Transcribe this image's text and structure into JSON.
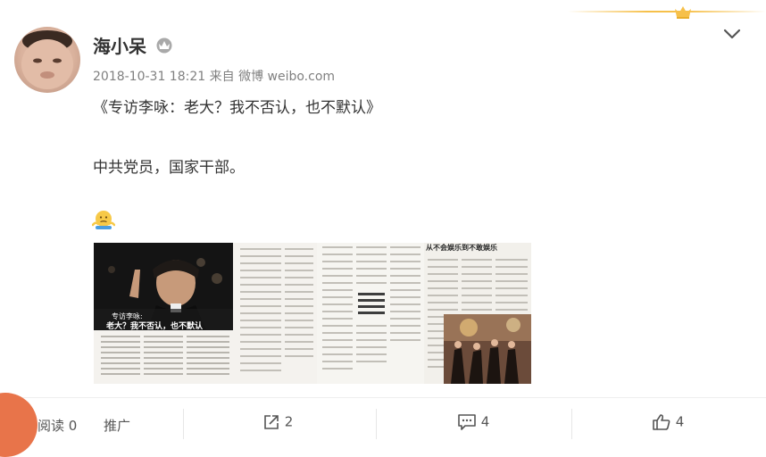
{
  "user": {
    "name": "海小呆",
    "vip_badge": "crown-badge-icon"
  },
  "post": {
    "timestamp": "2018-10-31 18:21",
    "source_prefix": "来自",
    "source": "微博 weibo.com",
    "line1": "《专访李咏：老大？我不否认，也不默认》",
    "line2": "中共党员，国家干部。",
    "emoji": "shrug-emoji-icon"
  },
  "image": {
    "caption_small": "专访李咏:",
    "caption_main": "老大？我不否认，也不默认",
    "right_headline": "从不会娱乐到不敢娱乐"
  },
  "footer": {
    "read_label": "阅读 0",
    "promote_label": "推广",
    "repost_count": "2",
    "comment_count": "4",
    "like_count": "4"
  },
  "colors": {
    "accent_gold": "#f6c04a",
    "text_main": "#333333",
    "text_meta": "#808080"
  }
}
